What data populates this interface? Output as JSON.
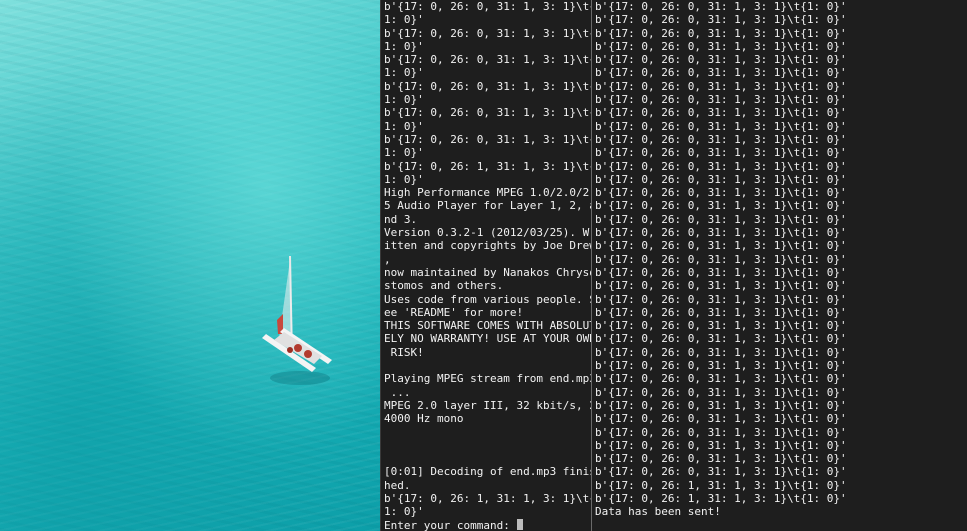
{
  "left_terminal": {
    "lines": [
      "b'{17: 0, 26: 0, 31: 1, 3: 1}\\t{",
      "1: 0}'",
      "b'{17: 0, 26: 0, 31: 1, 3: 1}\\t{",
      "1: 0}'",
      "b'{17: 0, 26: 0, 31: 1, 3: 1}\\t{",
      "1: 0}'",
      "b'{17: 0, 26: 0, 31: 1, 3: 1}\\t{",
      "1: 0}'",
      "b'{17: 0, 26: 0, 31: 1, 3: 1}\\t{",
      "1: 0}'",
      "b'{17: 0, 26: 0, 31: 1, 3: 1}\\t{",
      "1: 0}'",
      "b'{17: 0, 26: 1, 31: 1, 3: 1}\\t{",
      "1: 0}'",
      "High Performance MPEG 1.0/2.0/2.",
      "5 Audio Player for Layer 1, 2, a",
      "nd 3.",
      "Version 0.3.2-1 (2012/03/25). Wr",
      "itten and copyrights by Joe Drew",
      ",",
      "now maintained by Nanakos Chryso",
      "stomos and others.",
      "Uses code from various people. S",
      "ee 'README' for more!",
      "THIS SOFTWARE COMES WITH ABSOLUT",
      "ELY NO WARRANTY! USE AT YOUR OWN",
      " RISK!",
      "",
      "Playing MPEG stream from end.mp3",
      " ...",
      "MPEG 2.0 layer III, 32 kbit/s, 2",
      "4000 Hz mono",
      "",
      "",
      "",
      "[0:01] Decoding of end.mp3 finis",
      "hed.",
      "b'{17: 0, 26: 1, 31: 1, 3: 1}\\t{",
      "1: 0}'"
    ],
    "prompt": "Enter your command: "
  },
  "right_terminal": {
    "lines": [
      "b'{17: 0, 26: 0, 31: 1, 3: 1}\\t{1: 0}'",
      "b'{17: 0, 26: 0, 31: 1, 3: 1}\\t{1: 0}'",
      "b'{17: 0, 26: 0, 31: 1, 3: 1}\\t{1: 0}'",
      "b'{17: 0, 26: 0, 31: 1, 3: 1}\\t{1: 0}'",
      "b'{17: 0, 26: 0, 31: 1, 3: 1}\\t{1: 0}'",
      "b'{17: 0, 26: 0, 31: 1, 3: 1}\\t{1: 0}'",
      "b'{17: 0, 26: 0, 31: 1, 3: 1}\\t{1: 0}'",
      "b'{17: 0, 26: 0, 31: 1, 3: 1}\\t{1: 0}'",
      "b'{17: 0, 26: 0, 31: 1, 3: 1}\\t{1: 0}'",
      "b'{17: 0, 26: 0, 31: 1, 3: 1}\\t{1: 0}'",
      "b'{17: 0, 26: 0, 31: 1, 3: 1}\\t{1: 0}'",
      "b'{17: 0, 26: 0, 31: 1, 3: 1}\\t{1: 0}'",
      "b'{17: 0, 26: 0, 31: 1, 3: 1}\\t{1: 0}'",
      "b'{17: 0, 26: 0, 31: 1, 3: 1}\\t{1: 0}'",
      "b'{17: 0, 26: 0, 31: 1, 3: 1}\\t{1: 0}'",
      "b'{17: 0, 26: 0, 31: 1, 3: 1}\\t{1: 0}'",
      "b'{17: 0, 26: 0, 31: 1, 3: 1}\\t{1: 0}'",
      "b'{17: 0, 26: 0, 31: 1, 3: 1}\\t{1: 0}'",
      "b'{17: 0, 26: 0, 31: 1, 3: 1}\\t{1: 0}'",
      "b'{17: 0, 26: 0, 31: 1, 3: 1}\\t{1: 0}'",
      "b'{17: 0, 26: 0, 31: 1, 3: 1}\\t{1: 0}'",
      "b'{17: 0, 26: 0, 31: 1, 3: 1}\\t{1: 0}'",
      "b'{17: 0, 26: 0, 31: 1, 3: 1}\\t{1: 0}'",
      "b'{17: 0, 26: 0, 31: 1, 3: 1}\\t{1: 0}'",
      "b'{17: 0, 26: 0, 31: 1, 3: 1}\\t{1: 0}'",
      "b'{17: 0, 26: 0, 31: 1, 3: 1}\\t{1: 0}'",
      "b'{17: 0, 26: 0, 31: 1, 3: 1}\\t{1: 0}'",
      "b'{17: 0, 26: 0, 31: 1, 3: 1}\\t{1: 0}'",
      "b'{17: 0, 26: 0, 31: 1, 3: 1}\\t{1: 0}'",
      "b'{17: 0, 26: 0, 31: 1, 3: 1}\\t{1: 0}'",
      "b'{17: 0, 26: 0, 31: 1, 3: 1}\\t{1: 0}'",
      "b'{17: 0, 26: 0, 31: 1, 3: 1}\\t{1: 0}'",
      "b'{17: 0, 26: 0, 31: 1, 3: 1}\\t{1: 0}'",
      "b'{17: 0, 26: 0, 31: 1, 3: 1}\\t{1: 0}'",
      "b'{17: 0, 26: 0, 31: 1, 3: 1}\\t{1: 0}'",
      "b'{17: 0, 26: 0, 31: 1, 3: 1}\\t{1: 0}'",
      "b'{17: 0, 26: 1, 31: 1, 3: 1}\\t{1: 0}'",
      "b'{17: 0, 26: 1, 31: 1, 3: 1}\\t{1: 0}'",
      "Data has been sent!"
    ]
  },
  "wallpaper": {
    "sea_color": "#1ab3b9"
  }
}
